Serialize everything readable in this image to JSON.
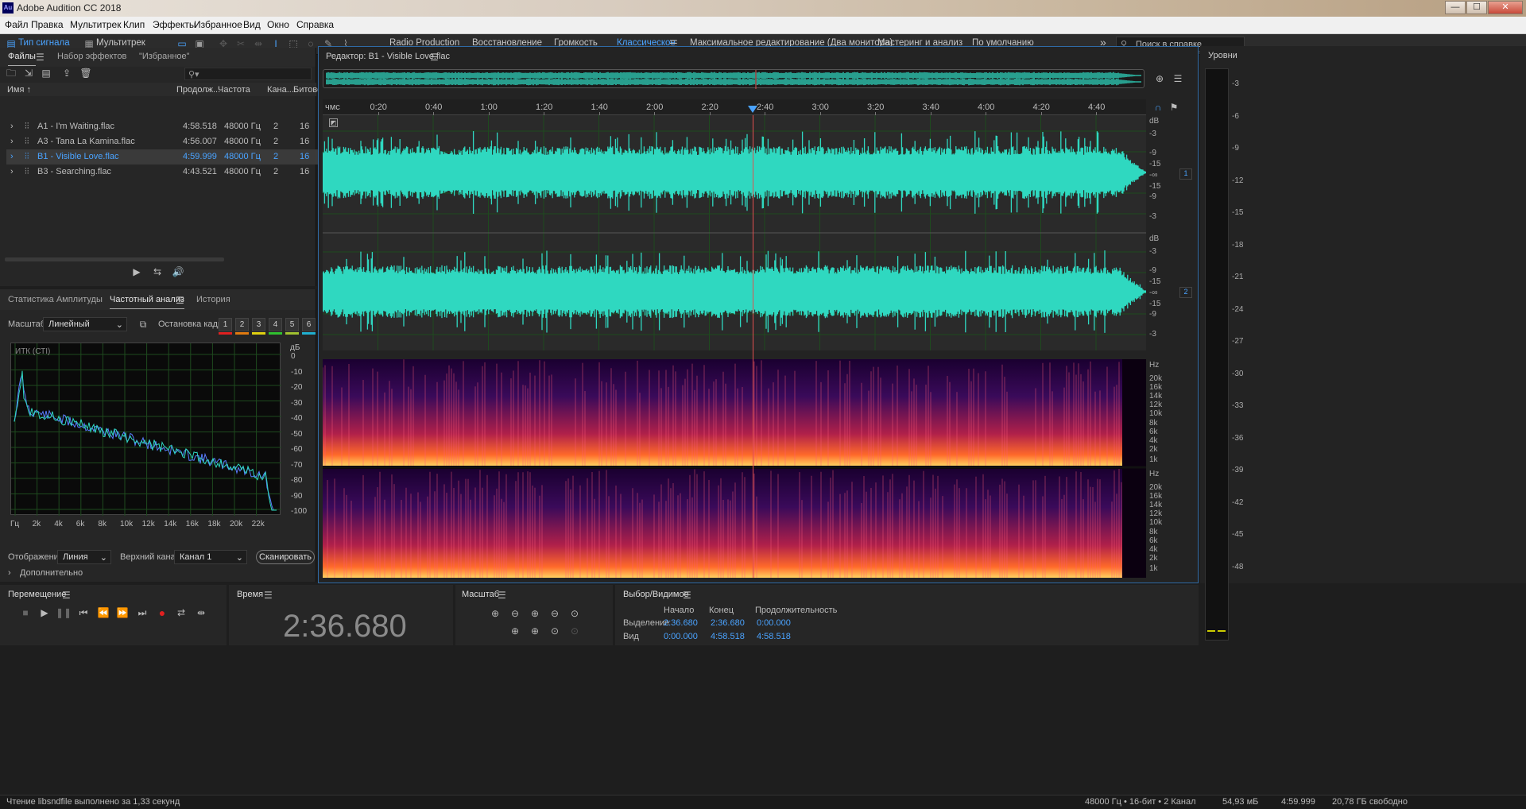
{
  "window": {
    "title": "Adobe Audition CC 2018",
    "icon_text": "Au",
    "min": "—",
    "max": "☐",
    "close": "✕"
  },
  "menu": [
    "Файл",
    "Правка",
    "Мультитрек",
    "Клип",
    "Эффекты",
    "Избранное",
    "Вид",
    "Окно",
    "Справка"
  ],
  "toolbar": {
    "view_waveform": "Тип сигнала",
    "view_multitrack": "Мультитрек",
    "workspaces": [
      "Radio Production",
      "Восстановление",
      "Громкость",
      "Классическое",
      "Максимальное редактирование (Два монитора)",
      "Мастеринг и анализ",
      "По умолчанию"
    ],
    "active_workspace": "Классическое",
    "more": "»",
    "search_placeholder": "Поиск в справке"
  },
  "files_panel": {
    "tabs": [
      "Файлы",
      "Набор эффектов",
      "\"Избранное\""
    ],
    "search_icon": "⚲▾",
    "columns": [
      "Имя ↑",
      "Продолж...",
      "Частота",
      "Кана...",
      "Битове"
    ],
    "rows": [
      {
        "name": "A1 - I'm Waiting.flac",
        "duration": "4:58.518",
        "rate": "48000 Гц",
        "channels": "2",
        "bits": "16"
      },
      {
        "name": "A3 - Tana La Kamina.flac",
        "duration": "4:56.007",
        "rate": "48000 Гц",
        "channels": "2",
        "bits": "16"
      },
      {
        "name": "B1 - Visible Love.flac",
        "duration": "4:59.999",
        "rate": "48000 Гц",
        "channels": "2",
        "bits": "16"
      },
      {
        "name": "B3 - Searching.flac",
        "duration": "4:43.521",
        "rate": "48000 Гц",
        "channels": "2",
        "bits": "16"
      }
    ],
    "selected_index": 2
  },
  "analysis_panel": {
    "tabs": [
      "Статистика Амплитуды",
      "Частотный анализ",
      "История"
    ],
    "scale_label": "Масштаб:",
    "scale_value": "Линейный",
    "freeze_label": "Остановка кадра:",
    "freeze_slots": [
      "1",
      "2",
      "3",
      "4",
      "5",
      "6"
    ],
    "freeze_colors": [
      "#e02020",
      "#e07a10",
      "#e0d010",
      "#30c030",
      "#a0c030",
      "#20b0d0"
    ],
    "chart_channel_label": "ИТК (СТI)",
    "db_unit": "дБ",
    "db_ticks": [
      "0",
      "-10",
      "-20",
      "-30",
      "-40",
      "-50",
      "-60",
      "-70",
      "-80",
      "-90",
      "-100"
    ],
    "freq_ticks": [
      "Гц",
      "2k",
      "4k",
      "6k",
      "8k",
      "10k",
      "12k",
      "14k",
      "16k",
      "18k",
      "20k",
      "22k"
    ],
    "display_label": "Отображение:",
    "display_value": "Линия",
    "top_channel_label": "Верхний канал:",
    "top_channel_value": "Канал 1",
    "scan_button": "Сканировать",
    "advanced": "Дополнительно"
  },
  "editor": {
    "title": "Редактор: B1 - Visible Love.flac",
    "ruler_unit": "чмс",
    "ruler_ticks": [
      "0:20",
      "0:40",
      "1:00",
      "1:20",
      "1:40",
      "2:00",
      "2:20",
      "2:40",
      "3:00",
      "3:20",
      "3:40",
      "4:00",
      "4:20",
      "4:40"
    ],
    "db_ticks_top": [
      "dB",
      "-3",
      "-9",
      "-15",
      "-∞",
      "-15",
      "-9",
      "-3"
    ],
    "channel_badges": [
      "1",
      "2"
    ],
    "hz_ticks": [
      "Hz",
      "20k",
      "16k",
      "14k",
      "12k",
      "10k",
      "8k",
      "6k",
      "4k",
      "2k",
      "1k"
    ],
    "playhead_fraction": 0.522,
    "waveform_color": "#2fd8c0"
  },
  "levels": {
    "title": "Уровни",
    "ticks": [
      "-3",
      "-6",
      "-9",
      "-12",
      "-15",
      "-18",
      "-21",
      "-24",
      "-27",
      "-30",
      "-33",
      "-36",
      "-39",
      "-42",
      "-45",
      "-48"
    ]
  },
  "transport": {
    "title": "Перемещение",
    "buttons": [
      "stop",
      "play",
      "pause",
      "to-start",
      "rewind",
      "fast-forward",
      "to-end",
      "record",
      "loop",
      "skip"
    ]
  },
  "time": {
    "title": "Время",
    "value": "2:36.680"
  },
  "zoom": {
    "title": "Масштаб"
  },
  "selection": {
    "title": "Выбор/Видимое",
    "col_start": "Начало",
    "col_end": "Конец",
    "col_duration": "Продолжительность",
    "sel_label": "Выделение",
    "sel_start": "2:36.680",
    "sel_end": "2:36.680",
    "sel_duration": "0:00.000",
    "view_label": "Вид",
    "view_start": "0:00.000",
    "view_end": "4:58.518",
    "view_duration": "4:58.518"
  },
  "status": {
    "message": "Чтение libsndfile выполнено за 1,33 секунд",
    "format": "48000 Гц • 16-бит • 2 Канал",
    "size": "54,93 мБ",
    "duration": "4:59.999",
    "free": "20,78 ГБ свободно"
  }
}
